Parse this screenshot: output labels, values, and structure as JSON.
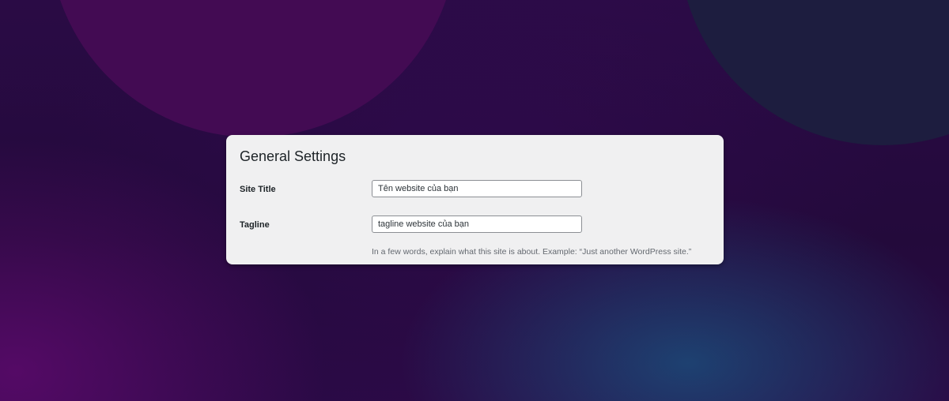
{
  "settings": {
    "title": "General Settings",
    "site_title": {
      "label": "Site Title",
      "value": "Tên website của bạn"
    },
    "tagline": {
      "label": "Tagline",
      "value": "tagline website của bạn",
      "description": "In a few words, explain what this site is about. Example: “Just another WordPress site.”"
    }
  },
  "colors": {
    "card_background": "#f0f0f1",
    "background_purple": "#250a3e",
    "circle_magenta": "#430b53",
    "circle_navy": "#1d1d3f"
  }
}
